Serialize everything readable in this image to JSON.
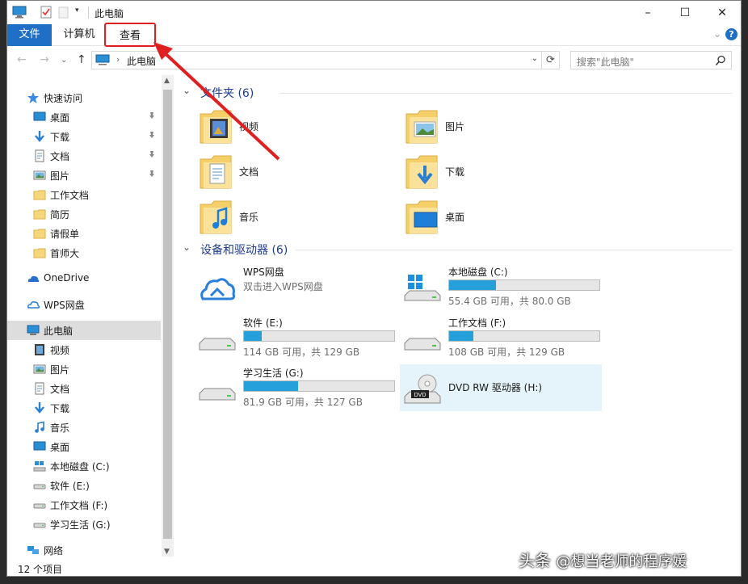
{
  "window": {
    "title": "此电脑",
    "minimize": "–",
    "maximize": "☐",
    "close": "✕"
  },
  "ribbon": {
    "tabs": [
      "文件",
      "计算机",
      "查看"
    ],
    "expand": "⌄",
    "help": "?"
  },
  "address": {
    "path": "此电脑",
    "separator": "›",
    "dropdown": "⌄",
    "refresh": "⟳",
    "search_placeholder": "搜索\"此电脑\""
  },
  "nav": {
    "back": "←",
    "forward": "→",
    "history": "⌄",
    "up": "↑"
  },
  "sidebar": {
    "items": [
      {
        "label": "快速访问",
        "icon": "star-icon",
        "pinned": false
      },
      {
        "label": "桌面",
        "icon": "desktop-icon",
        "pinned": true
      },
      {
        "label": "下载",
        "icon": "download-icon",
        "pinned": true
      },
      {
        "label": "文档",
        "icon": "document-icon",
        "pinned": true
      },
      {
        "label": "图片",
        "icon": "picture-icon",
        "pinned": true
      },
      {
        "label": "工作文档",
        "icon": "folder-icon",
        "pinned": false
      },
      {
        "label": "简历",
        "icon": "folder-icon",
        "pinned": false
      },
      {
        "label": "请假单",
        "icon": "folder-icon",
        "pinned": false
      },
      {
        "label": "首师大",
        "icon": "folder-icon",
        "pinned": false
      },
      {
        "label": "OneDrive",
        "icon": "onedrive-icon",
        "pinned": false
      },
      {
        "label": "WPS网盘",
        "icon": "wps-cloud-icon",
        "pinned": false
      },
      {
        "label": "此电脑",
        "icon": "computer-icon",
        "pinned": false
      },
      {
        "label": "视频",
        "icon": "video-icon",
        "pinned": false
      },
      {
        "label": "图片",
        "icon": "picture-icon",
        "pinned": false
      },
      {
        "label": "文档",
        "icon": "document-icon",
        "pinned": false
      },
      {
        "label": "下载",
        "icon": "download-icon",
        "pinned": false
      },
      {
        "label": "音乐",
        "icon": "music-icon",
        "pinned": false
      },
      {
        "label": "桌面",
        "icon": "desktop-icon",
        "pinned": false
      },
      {
        "label": "本地磁盘 (C:)",
        "icon": "windows-drive-icon",
        "pinned": false
      },
      {
        "label": "软件 (E:)",
        "icon": "drive-icon",
        "pinned": false
      },
      {
        "label": "工作文档 (F:)",
        "icon": "drive-icon",
        "pinned": false
      },
      {
        "label": "学习生活 (G:)",
        "icon": "drive-icon",
        "pinned": false
      },
      {
        "label": "网络",
        "icon": "network-icon",
        "pinned": false
      }
    ],
    "pin_glyph": "📌"
  },
  "content": {
    "folders_group": "文件夹 (6)",
    "folders": [
      {
        "label": "视频",
        "icon": "video-folder-icon"
      },
      {
        "label": "图片",
        "icon": "pictures-folder-icon"
      },
      {
        "label": "文档",
        "icon": "documents-folder-icon"
      },
      {
        "label": "下载",
        "icon": "downloads-folder-icon"
      },
      {
        "label": "音乐",
        "icon": "music-folder-icon"
      },
      {
        "label": "桌面",
        "icon": "desktop-folder-icon"
      }
    ],
    "devices_group": "设备和驱动器 (6)",
    "devices": [
      {
        "name": "WPS网盘",
        "sub": "双击进入WPS网盘",
        "icon": "wps-cloud-icon"
      },
      {
        "name": "本地磁盘 (C:)",
        "sub": "55.4 GB 可用，共 80.0 GB",
        "used_fraction": 0.31,
        "icon": "windows-drive-icon"
      },
      {
        "name": "软件 (E:)",
        "sub": "114 GB 可用，共 129 GB",
        "used_fraction": 0.12,
        "icon": "drive-icon"
      },
      {
        "name": "工作文档 (F:)",
        "sub": "108 GB 可用，共 129 GB",
        "used_fraction": 0.16,
        "icon": "drive-icon"
      },
      {
        "name": "学习生活 (G:)",
        "sub": "81.9 GB 可用，共 127 GB",
        "used_fraction": 0.36,
        "icon": "drive-icon"
      },
      {
        "name": "DVD RW 驱动器 (H:)",
        "sub": "",
        "icon": "dvd-drive-icon"
      }
    ]
  },
  "status": {
    "count": "12 个项目"
  },
  "watermark": {
    "prefix": "头条",
    "handle": "@想当老师的程序媛"
  },
  "colors": {
    "accent": "#1e6fc5",
    "bar_fill": "#26a0da",
    "highlight": "#e5f3fb",
    "annotation": "#e02020"
  }
}
